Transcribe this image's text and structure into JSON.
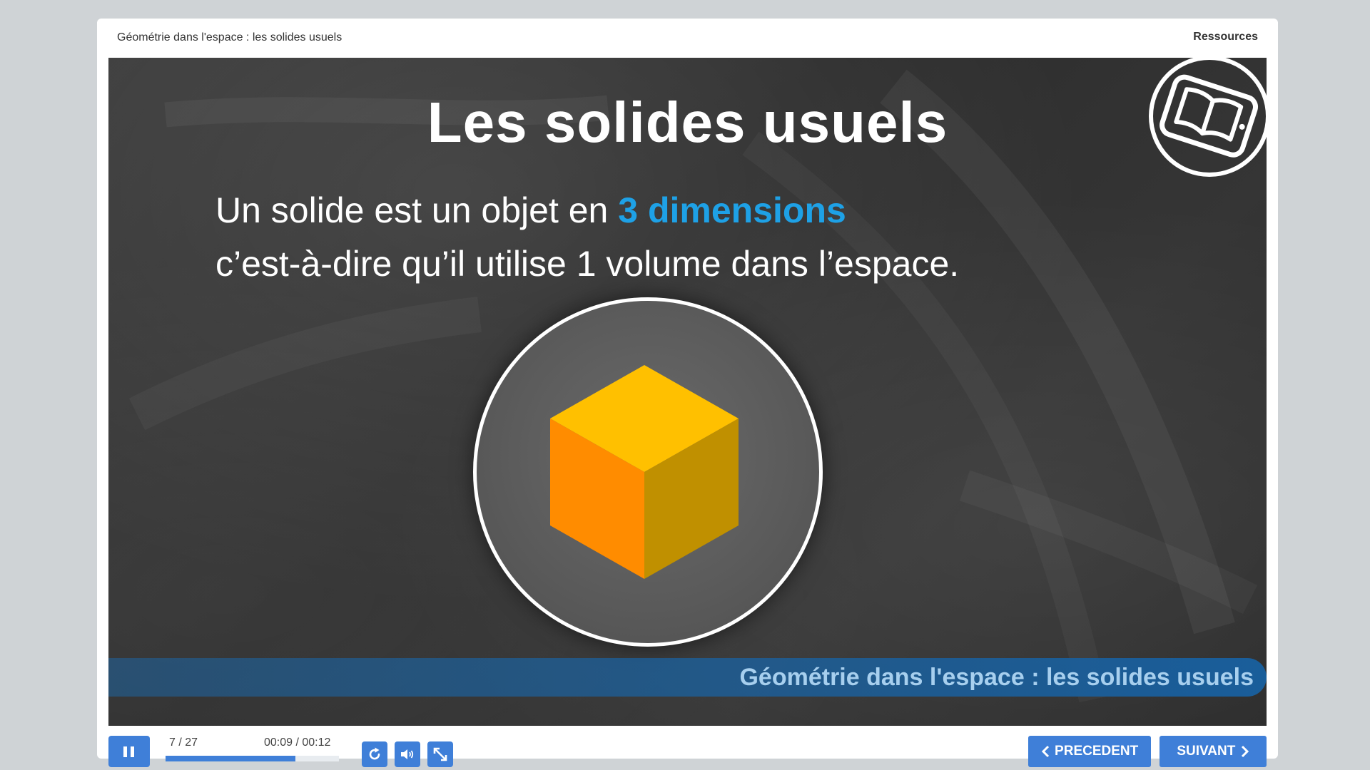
{
  "header": {
    "course_title": "Géométrie dans l'espace : les solides usuels",
    "resources_label": "Ressources"
  },
  "slide": {
    "title": "Les solides usuels",
    "line1_prefix": "Un solide est un objet en ",
    "line1_highlight": "3 dimensions",
    "line2": "c’est-à-dire qu’il utilise 1 volume dans l’espace.",
    "caption": "Géométrie dans l'espace : les solides usuels",
    "highlight_color": "#1ea1e6",
    "cube_colors": {
      "top": "#ffc000",
      "left": "#ff8c00",
      "right": "#c09000"
    }
  },
  "controls": {
    "pause_icon": "pause-icon",
    "slide_counter": "7 / 27",
    "time_display": "00:09 / 00:12",
    "progress": 0.75,
    "replay_icon": "replay-icon",
    "volume_icon": "volume-icon",
    "fullscreen_icon": "fullscreen-icon",
    "previous_label": "PRECEDENT",
    "next_label": "SUIVANT",
    "accent_color": "#3f7fd8"
  }
}
